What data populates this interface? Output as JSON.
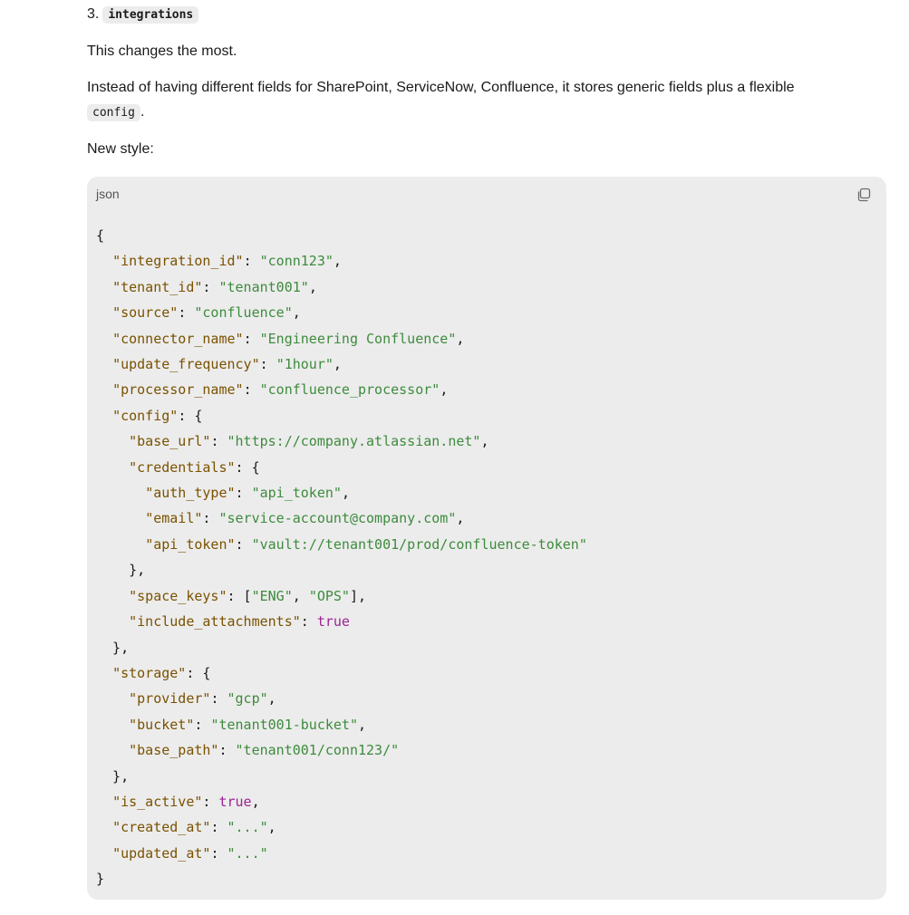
{
  "heading": {
    "number": "3.",
    "code": "integrations"
  },
  "paragraphs": {
    "intro": "This changes the most.",
    "description_part1": "Instead of having different fields for SharePoint, ServiceNow, Confluence, it stores generic fields plus a flexible",
    "description_code": "config",
    "description_end": ".",
    "new_style": "New style:"
  },
  "code_block": {
    "language": "json",
    "copy_icon": "copy-icon",
    "lines": [
      [
        [
          "p",
          "{"
        ]
      ],
      [
        [
          "p",
          "  "
        ],
        [
          "k",
          "\"integration_id\""
        ],
        [
          "p",
          ": "
        ],
        [
          "s",
          "\"conn123\""
        ],
        [
          "p",
          ","
        ]
      ],
      [
        [
          "p",
          "  "
        ],
        [
          "k",
          "\"tenant_id\""
        ],
        [
          "p",
          ": "
        ],
        [
          "s",
          "\"tenant001\""
        ],
        [
          "p",
          ","
        ]
      ],
      [
        [
          "p",
          "  "
        ],
        [
          "k",
          "\"source\""
        ],
        [
          "p",
          ": "
        ],
        [
          "s",
          "\"confluence\""
        ],
        [
          "p",
          ","
        ]
      ],
      [
        [
          "p",
          "  "
        ],
        [
          "k",
          "\"connector_name\""
        ],
        [
          "p",
          ": "
        ],
        [
          "s",
          "\"Engineering Confluence\""
        ],
        [
          "p",
          ","
        ]
      ],
      [
        [
          "p",
          "  "
        ],
        [
          "k",
          "\"update_frequency\""
        ],
        [
          "p",
          ": "
        ],
        [
          "s",
          "\"1hour\""
        ],
        [
          "p",
          ","
        ]
      ],
      [
        [
          "p",
          "  "
        ],
        [
          "k",
          "\"processor_name\""
        ],
        [
          "p",
          ": "
        ],
        [
          "s",
          "\"confluence_processor\""
        ],
        [
          "p",
          ","
        ]
      ],
      [
        [
          "p",
          "  "
        ],
        [
          "k",
          "\"config\""
        ],
        [
          "p",
          ": {"
        ]
      ],
      [
        [
          "p",
          "    "
        ],
        [
          "k",
          "\"base_url\""
        ],
        [
          "p",
          ": "
        ],
        [
          "s",
          "\"https://company.atlassian.net\""
        ],
        [
          "p",
          ","
        ]
      ],
      [
        [
          "p",
          "    "
        ],
        [
          "k",
          "\"credentials\""
        ],
        [
          "p",
          ": {"
        ]
      ],
      [
        [
          "p",
          "      "
        ],
        [
          "k",
          "\"auth_type\""
        ],
        [
          "p",
          ": "
        ],
        [
          "s",
          "\"api_token\""
        ],
        [
          "p",
          ","
        ]
      ],
      [
        [
          "p",
          "      "
        ],
        [
          "k",
          "\"email\""
        ],
        [
          "p",
          ": "
        ],
        [
          "s",
          "\"service-account@company.com\""
        ],
        [
          "p",
          ","
        ]
      ],
      [
        [
          "p",
          "      "
        ],
        [
          "k",
          "\"api_token\""
        ],
        [
          "p",
          ": "
        ],
        [
          "s",
          "\"vault://tenant001/prod/confluence-token\""
        ]
      ],
      [
        [
          "p",
          "    },"
        ]
      ],
      [
        [
          "p",
          "    "
        ],
        [
          "k",
          "\"space_keys\""
        ],
        [
          "p",
          ": ["
        ],
        [
          "s",
          "\"ENG\""
        ],
        [
          "p",
          ", "
        ],
        [
          "s",
          "\"OPS\""
        ],
        [
          "p",
          "],"
        ]
      ],
      [
        [
          "p",
          "    "
        ],
        [
          "k",
          "\"include_attachments\""
        ],
        [
          "p",
          ": "
        ],
        [
          "b",
          "true"
        ]
      ],
      [
        [
          "p",
          "  },"
        ]
      ],
      [
        [
          "p",
          "  "
        ],
        [
          "k",
          "\"storage\""
        ],
        [
          "p",
          ": {"
        ]
      ],
      [
        [
          "p",
          "    "
        ],
        [
          "k",
          "\"provider\""
        ],
        [
          "p",
          ": "
        ],
        [
          "s",
          "\"gcp\""
        ],
        [
          "p",
          ","
        ]
      ],
      [
        [
          "p",
          "    "
        ],
        [
          "k",
          "\"bucket\""
        ],
        [
          "p",
          ": "
        ],
        [
          "s",
          "\"tenant001-bucket\""
        ],
        [
          "p",
          ","
        ]
      ],
      [
        [
          "p",
          "    "
        ],
        [
          "k",
          "\"base_path\""
        ],
        [
          "p",
          ": "
        ],
        [
          "s",
          "\"tenant001/conn123/\""
        ]
      ],
      [
        [
          "p",
          "  },"
        ]
      ],
      [
        [
          "p",
          "  "
        ],
        [
          "k",
          "\"is_active\""
        ],
        [
          "p",
          ": "
        ],
        [
          "b",
          "true"
        ],
        [
          "p",
          ","
        ]
      ],
      [
        [
          "p",
          "  "
        ],
        [
          "k",
          "\"created_at\""
        ],
        [
          "p",
          ": "
        ],
        [
          "s",
          "\"...\""
        ],
        [
          "p",
          ","
        ]
      ],
      [
        [
          "p",
          "  "
        ],
        [
          "k",
          "\"updated_at\""
        ],
        [
          "p",
          ": "
        ],
        [
          "s",
          "\"...\""
        ]
      ],
      [
        [
          "p",
          "}"
        ]
      ]
    ]
  }
}
